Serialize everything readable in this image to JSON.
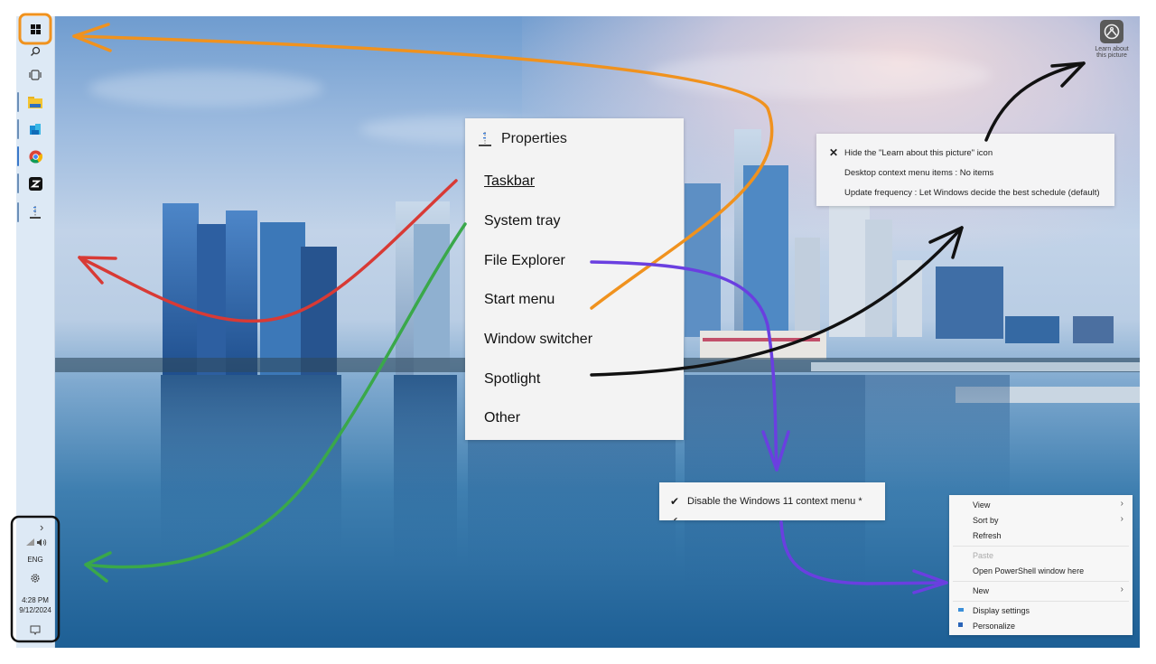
{
  "taskbar": {
    "items": [
      {
        "name": "start",
        "icon": "windows-icon"
      },
      {
        "name": "search",
        "icon": "search-icon"
      },
      {
        "name": "task-view",
        "icon": "task-view-icon"
      },
      {
        "name": "file-explorer",
        "icon": "folder-icon"
      },
      {
        "name": "store",
        "icon": "store-icon"
      },
      {
        "name": "chrome",
        "icon": "chrome-icon"
      },
      {
        "name": "zed",
        "icon": "z-app-icon"
      },
      {
        "name": "properties",
        "icon": "properties-icon"
      }
    ],
    "tray": {
      "expand": "›",
      "language": "ENG",
      "time": "4:28 PM",
      "date": "9/12/2024"
    }
  },
  "properties_menu": {
    "title": "Properties",
    "items": [
      "Taskbar",
      "System tray",
      "File Explorer",
      "Start menu",
      "Window switcher",
      "Spotlight",
      "Other"
    ]
  },
  "spotlight_panel": {
    "rows": [
      {
        "mark": "✕",
        "text": "Hide the \"Learn about this picture\" icon"
      },
      {
        "mark": "",
        "text": "Desktop context menu items : No items"
      },
      {
        "mark": "",
        "text": "Update frequency : Let Windows decide the best schedule (default)"
      }
    ]
  },
  "explorer_option": {
    "mark": "✔",
    "text": "Disable the Windows 11 context menu *"
  },
  "learn_picture": {
    "label_line1": "Learn about",
    "label_line2": "this picture"
  },
  "context_menu": {
    "items": [
      {
        "label": "View",
        "submenu": true,
        "disabled": false
      },
      {
        "label": "Sort by",
        "submenu": true,
        "disabled": false
      },
      {
        "label": "Refresh",
        "submenu": false,
        "disabled": false
      },
      {
        "label": "Paste",
        "submenu": false,
        "disabled": true
      },
      {
        "label": "Open PowerShell window here",
        "submenu": false,
        "disabled": false
      },
      {
        "label": "New",
        "submenu": true,
        "disabled": false
      },
      {
        "label": "Display settings",
        "submenu": false,
        "disabled": false
      },
      {
        "label": "Personalize",
        "submenu": false,
        "disabled": false
      }
    ],
    "chevron": "›"
  },
  "annotation_colors": {
    "start_arrow": "#f0921e",
    "taskbar_arrow": "#d83a35",
    "tray_arrow": "#3aa84a",
    "explorer_arrow": "#6a3fe0",
    "spotlight_arrow": "#111111"
  }
}
